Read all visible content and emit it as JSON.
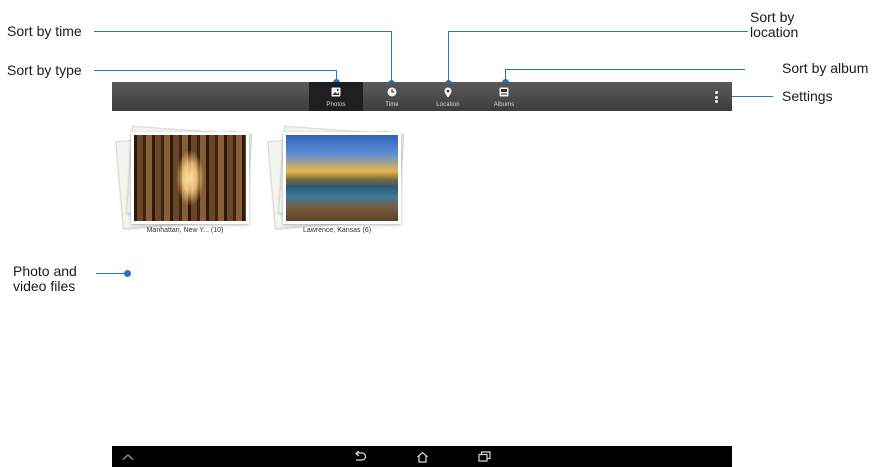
{
  "callouts": {
    "sort_by_time": "Sort by time",
    "sort_by_type": "Sort by type",
    "sort_by_location": "Sort by\nlocation",
    "sort_by_album": "Sort by album",
    "settings": "Settings",
    "photo_and_video_files": "Photo and\nvideo files"
  },
  "actionbar": {
    "tabs": [
      {
        "label": "Photos",
        "icon": "photo-icon",
        "selected": true
      },
      {
        "label": "Time",
        "icon": "clock-icon",
        "selected": false
      },
      {
        "label": "Location",
        "icon": "location-pin-icon",
        "selected": false
      },
      {
        "label": "Albums",
        "icon": "album-icon",
        "selected": false
      }
    ],
    "overflow_icon": "overflow-menu-icon"
  },
  "albums": [
    {
      "caption": "Manhattan, New Y... (10)"
    },
    {
      "caption": "Lawrence, Kansas (6)"
    }
  ],
  "navbar": {
    "icons": [
      "system-chevron-icon",
      "back-icon",
      "home-icon",
      "recent-apps-icon"
    ]
  },
  "colors": {
    "accent": "#1f78c8",
    "actionbar": "#4a4a4a",
    "navbar": "#000000"
  }
}
